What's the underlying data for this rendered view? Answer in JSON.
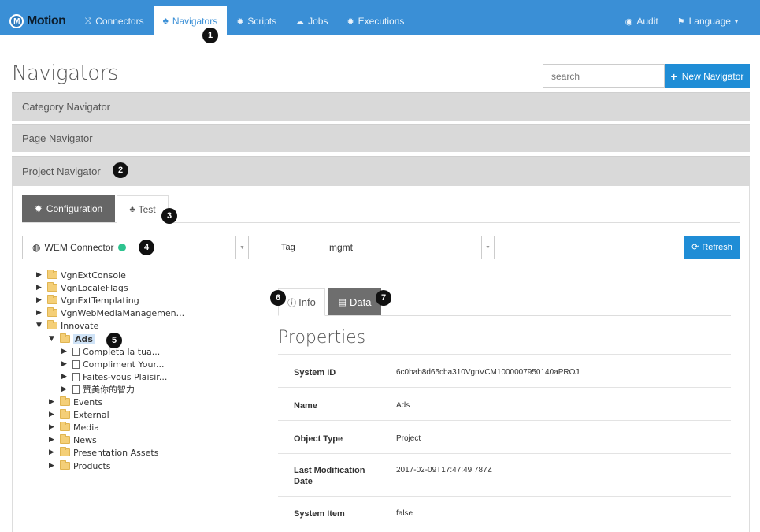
{
  "navbar": {
    "brand": "Motion",
    "brand_icon": "M",
    "items": [
      {
        "label": "Connectors",
        "icon": "shuffle-icon",
        "glyph": "⤨"
      },
      {
        "label": "Navigators",
        "icon": "sitemap-icon",
        "glyph": "♣"
      },
      {
        "label": "Scripts",
        "icon": "gear-icon",
        "glyph": "✹"
      },
      {
        "label": "Jobs",
        "icon": "cloud-icon",
        "glyph": "☁"
      },
      {
        "label": "Executions",
        "icon": "gear-icon",
        "glyph": "✹"
      }
    ],
    "right": [
      {
        "label": "Audit",
        "icon": "eye-icon",
        "glyph": "◉"
      },
      {
        "label": "Language",
        "icon": "flag-icon",
        "glyph": "⚑"
      }
    ]
  },
  "badges": [
    "1",
    "2",
    "3",
    "4",
    "5",
    "6",
    "7"
  ],
  "page": {
    "title": "Navigators",
    "search_placeholder": "search",
    "new_button": "New Navigator"
  },
  "accordion": [
    "Category Navigator",
    "Page Navigator",
    "Project Navigator"
  ],
  "config_tabs": {
    "configuration": "Configuration",
    "test": "Test"
  },
  "connector": {
    "label": "WEM Connector",
    "status_color": "#2ec38f"
  },
  "tag": {
    "label": "Tag",
    "value": "mgmt"
  },
  "refresh_label": "Refresh",
  "tree": [
    {
      "label": "VgnExtConsole",
      "type": "folder",
      "open": false
    },
    {
      "label": "VgnLocaleFlags",
      "type": "folder",
      "open": false
    },
    {
      "label": "VgnExtTemplating",
      "type": "folder",
      "open": false
    },
    {
      "label": "VgnWebMediaManagemen...",
      "type": "folder",
      "open": false
    },
    {
      "label": "Innovate",
      "type": "folder",
      "open": true
    },
    {
      "label": "Ads",
      "type": "folder",
      "open": true,
      "selected": true
    },
    {
      "label": "Completa la tua...",
      "type": "file",
      "open": false
    },
    {
      "label": "Compliment Your...",
      "type": "file",
      "open": false
    },
    {
      "label": "Faites-vous Plaisir...",
      "type": "file",
      "open": false
    },
    {
      "label": "赞美你的智力",
      "type": "file",
      "open": false
    },
    {
      "label": "Events",
      "type": "folder",
      "open": false
    },
    {
      "label": "External",
      "type": "folder",
      "open": false
    },
    {
      "label": "Media",
      "type": "folder",
      "open": false
    },
    {
      "label": "News",
      "type": "folder",
      "open": false
    },
    {
      "label": "Presentation Assets",
      "type": "folder",
      "open": false
    },
    {
      "label": "Products",
      "type": "folder",
      "open": false
    }
  ],
  "detail_tabs": {
    "info": "Info",
    "data": "Data"
  },
  "properties": {
    "title": "Properties",
    "rows": [
      {
        "key": "System ID",
        "value": "6c0bab8d65cba310VgnVCM1000007950140aPROJ"
      },
      {
        "key": "Name",
        "value": "Ads"
      },
      {
        "key": "Object Type",
        "value": "Project"
      },
      {
        "key": "Last Modification Date",
        "value": "2017-02-09T17:47:49.787Z"
      },
      {
        "key": "System Item",
        "value": "false"
      }
    ]
  }
}
